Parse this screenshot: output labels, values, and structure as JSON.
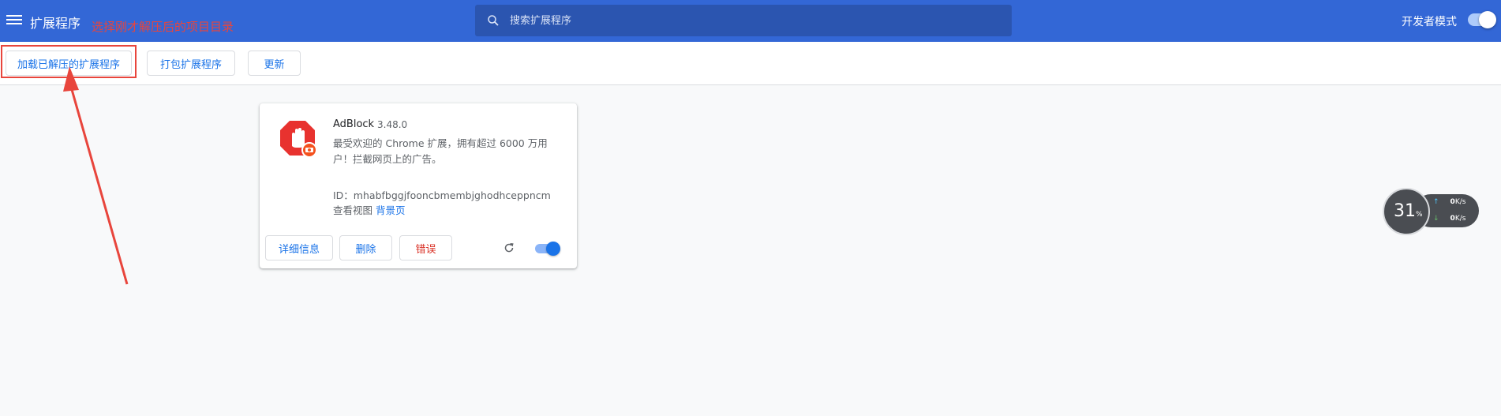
{
  "header": {
    "title": "扩展程序",
    "annotation": "选择刚才解压后的项目目录",
    "search_placeholder": "搜索扩展程序",
    "dev_mode_label": "开发者模式",
    "dev_mode_enabled": true
  },
  "toolbar": {
    "load_unpacked": "加载已解压的扩展程序",
    "pack_extension": "打包扩展程序",
    "update": "更新"
  },
  "extension": {
    "name": "AdBlock",
    "version": "3.48.0",
    "description": "最受欢迎的 Chrome 扩展，拥有超过 6000 万用户！拦截网页上的广告。",
    "id_text": "ID：mhabfbggjfooncbmembjghodhceppncm",
    "views_label": "查看视图",
    "views_link": "背景页",
    "details_button": "详细信息",
    "remove_button": "删除",
    "errors_button": "错误",
    "enabled": true
  },
  "network_widget": {
    "percent": "31",
    "percent_unit": "%",
    "up_value": "0",
    "up_unit": "K/s",
    "down_value": "0",
    "down_unit": "K/s"
  },
  "colors": {
    "header": "#3367d6",
    "accent": "#1a73e8",
    "annotation": "#e8453c",
    "error": "#d93025"
  }
}
